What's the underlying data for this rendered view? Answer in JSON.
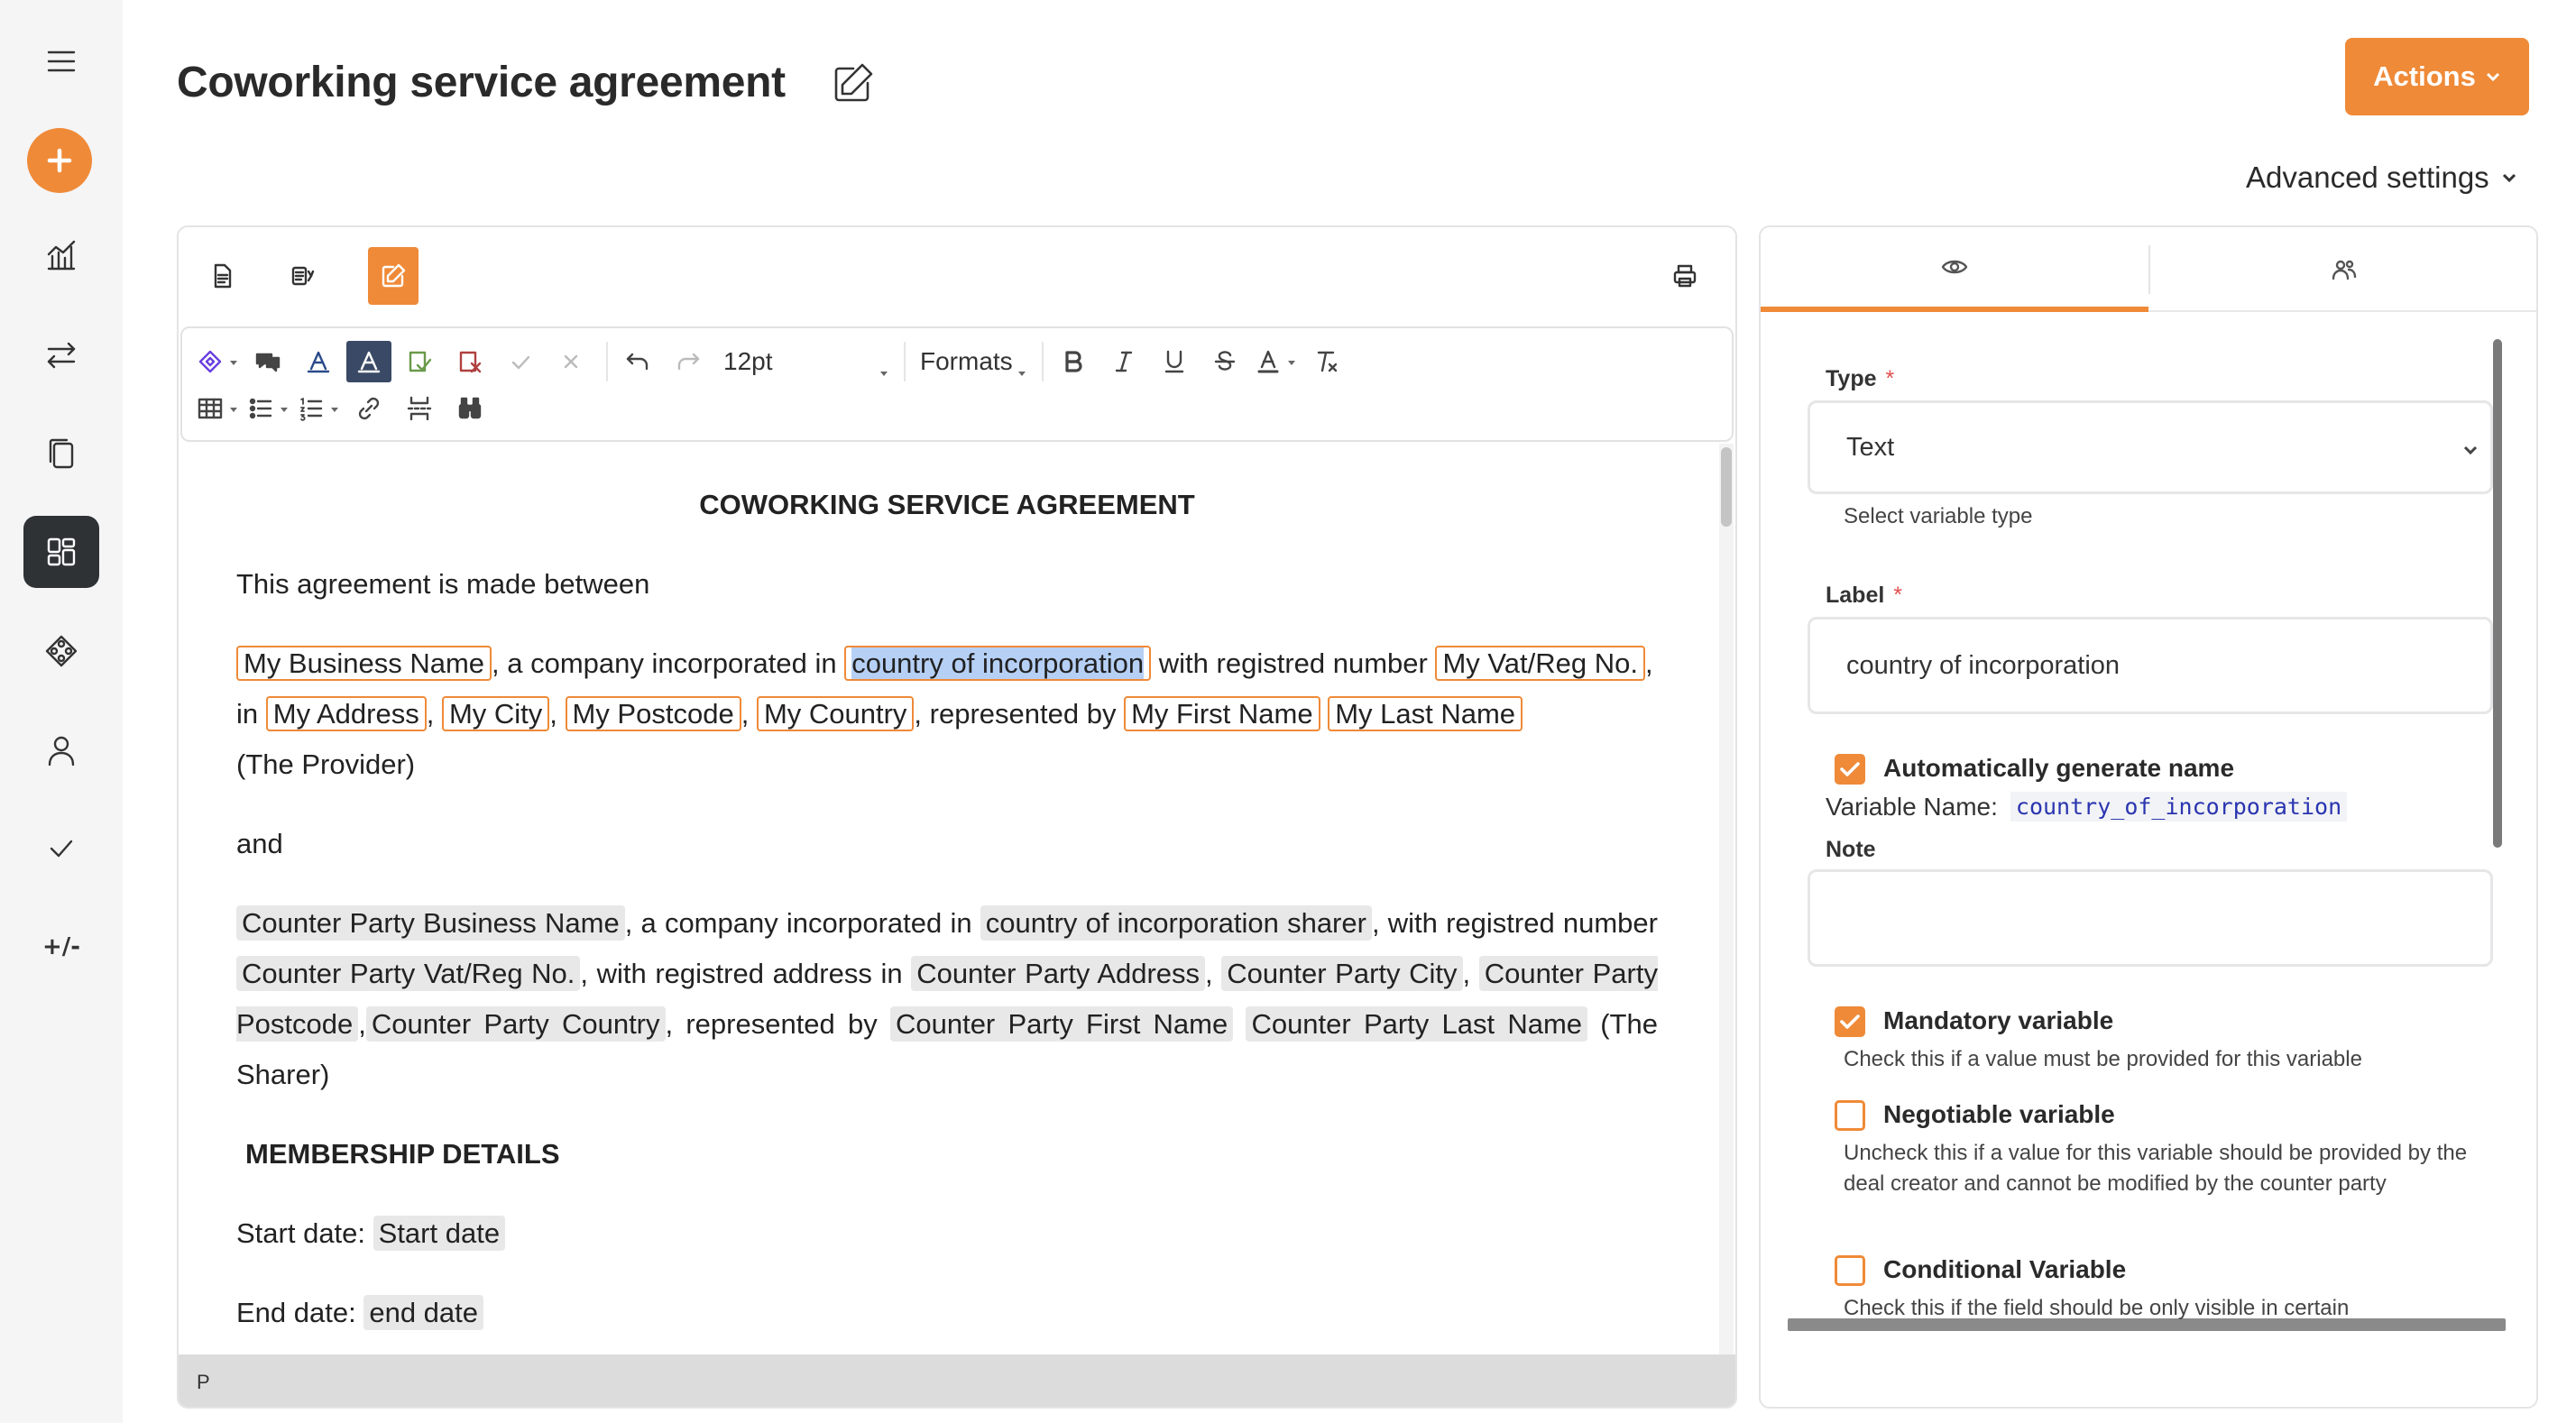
{
  "sidebar": {
    "diff_label": "+/-"
  },
  "header": {
    "title": "Coworking service agreement",
    "actions_label": "Actions",
    "advanced_settings_label": "Advanced settings"
  },
  "toolbar": {
    "font_size": "12pt",
    "formats_label": "Formats"
  },
  "document": {
    "heading": "COWORKING SERVICE AGREEMENT",
    "intro": "This agreement is made  between",
    "provider": {
      "business_name": "My Business Name",
      "t1": ", a company incorporated in ",
      "country_inc": "country of incorporation",
      "t2": " with registred number ",
      "vat": "My Vat/Reg No.",
      "t3": ", in ",
      "address": "My Address",
      "t4": ", ",
      "city": "My City",
      "t5": ", ",
      "postcode": "My Postcode",
      "t6": ", ",
      "country": "My Country",
      "t7": ", represented by ",
      "first_name": "My First Name",
      "t8": " ",
      "last_name": "My Last Name",
      "t9": " (The Provider)"
    },
    "and": "and",
    "sharer": {
      "business_name": "Counter Party Business Name",
      "t1": ", a company incorporated in ",
      "country_inc": "country of incorporation sharer",
      "t2": ", with registred number ",
      "vat": "Counter Party Vat/Reg No.",
      "t3": ", with registred address in ",
      "address": "Counter Party Address",
      "t4": ", ",
      "city": "Counter Party City",
      "t5": ", ",
      "postcode": "Counter Party Postcode",
      "t6": ",",
      "country": "Counter Party Country",
      "t7": ", represented by ",
      "first_name": "Counter Party First Name",
      "t8": " ",
      "last_name": "Counter Party Last Name",
      "t9": "  (The Sharer)"
    },
    "membership_heading": "MEMBERSHIP DETAILS",
    "start_label": "Start date: ",
    "start_var": "Start date",
    "end_label": "End date: ",
    "end_var": "end date",
    "status_path": "P"
  },
  "variable_panel": {
    "type_label": "Type",
    "type_value": "Text",
    "type_help": "Select variable type",
    "label_label": "Label",
    "label_value": "country of incorporation",
    "required_mark": "*",
    "auto_name_label": "Automatically generate name",
    "auto_name_checked": true,
    "variable_name_label": "Variable Name:",
    "variable_name_value": "country_of_incorporation",
    "note_label": "Note",
    "note_value": "",
    "mandatory_label": "Mandatory variable",
    "mandatory_checked": true,
    "mandatory_help": "Check this if a value must be provided for this variable",
    "negotiable_label": "Negotiable variable",
    "negotiable_checked": false,
    "negotiable_help": "Uncheck this if a value for this variable should be provided by the deal creator and cannot be modified by the counter party",
    "conditional_label": "Conditional Variable",
    "conditional_checked": false,
    "conditional_help": "Check this if the field should be only visible in certain"
  },
  "colors": {
    "accent": "#ef8a38",
    "sidebar_active": "#2e3235",
    "selection": "#b6d0f5",
    "variable_bg": "#e8e8e8"
  }
}
